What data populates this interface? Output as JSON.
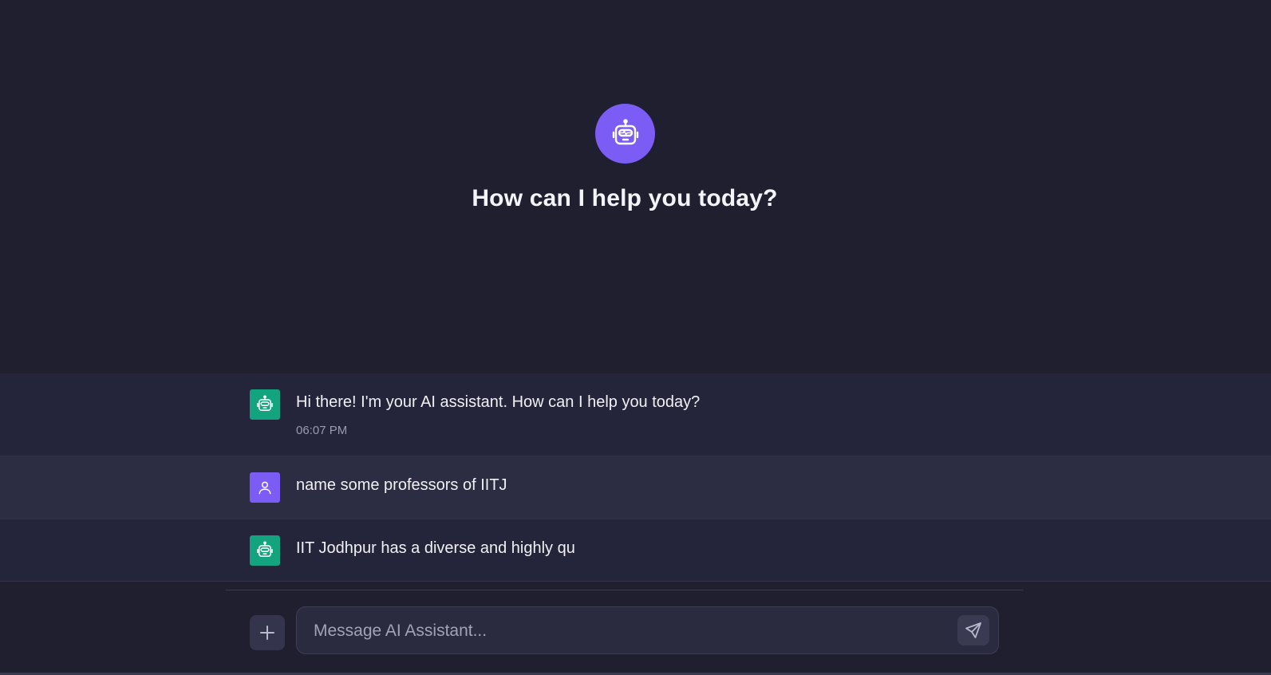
{
  "hero": {
    "avatar_icon": "robot-icon",
    "title": "How can I help you today?"
  },
  "messages": [
    {
      "role": "assistant",
      "avatar_icon": "robot-icon",
      "text": "Hi there! I'm your AI assistant. How can I help you today?",
      "time": "06:07 PM"
    },
    {
      "role": "user",
      "avatar_icon": "user-icon",
      "text": "name some professors of IITJ"
    },
    {
      "role": "assistant",
      "avatar_icon": "robot-icon",
      "text": "IIT Jodhpur has a diverse and highly qu"
    }
  ],
  "composer": {
    "add_icon": "plus-icon",
    "placeholder": "Message AI Assistant...",
    "value": "",
    "send_icon": "send-icon"
  },
  "colors": {
    "background": "#1f1f30",
    "accent": "#7b5cf5",
    "assistant_avatar": "#14a37f",
    "assistant_row": "#24243a",
    "user_row": "#2c2c42"
  }
}
